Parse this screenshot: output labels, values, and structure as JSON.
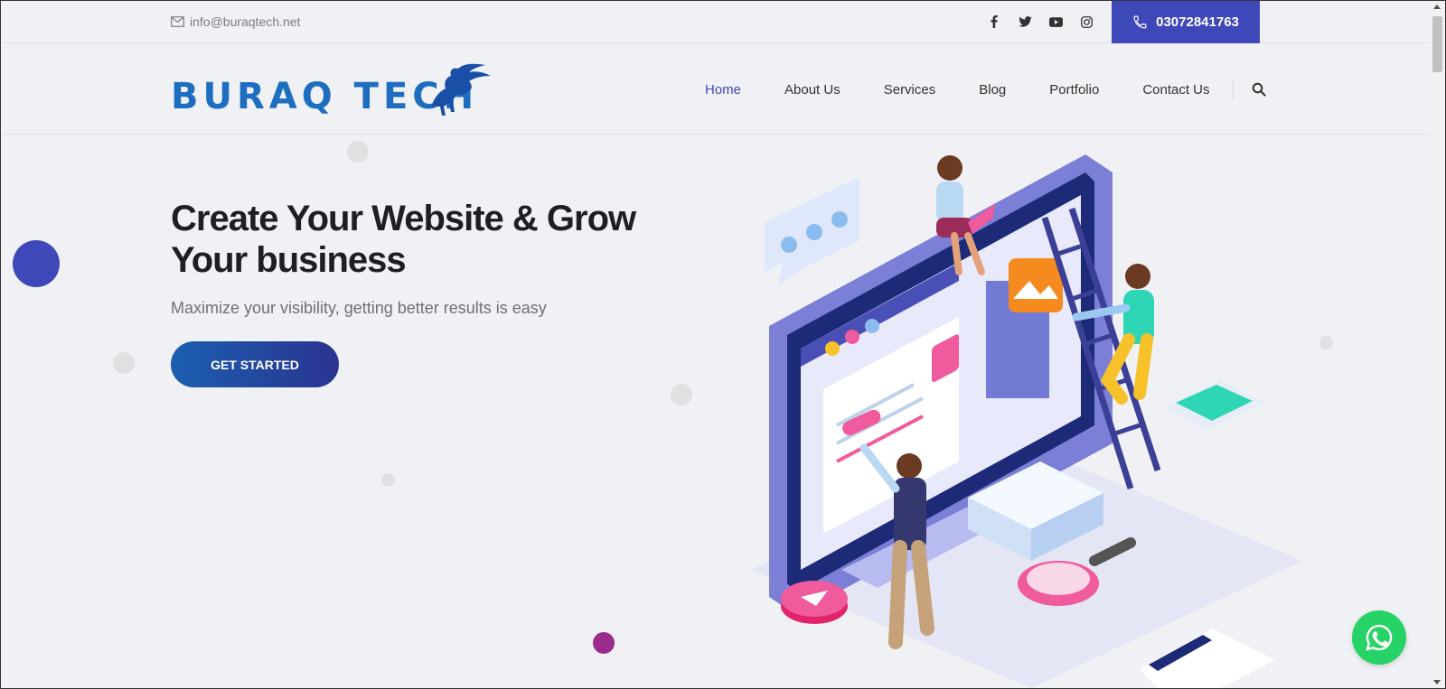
{
  "topbar": {
    "email": "info@buraqtech.net",
    "phone": "03072841763",
    "socials": [
      "facebook-icon",
      "twitter-icon",
      "youtube-icon",
      "instagram-icon"
    ]
  },
  "logo": {
    "text": "BURAQ TECH"
  },
  "nav": {
    "items": [
      {
        "label": "Home",
        "active": true
      },
      {
        "label": "About Us"
      },
      {
        "label": "Services"
      },
      {
        "label": "Blog"
      },
      {
        "label": "Portfolio"
      },
      {
        "label": "Contact Us"
      }
    ]
  },
  "hero": {
    "title": "Create Your Website & Grow Your business",
    "subtitle": "Maximize your visibility, getting better results is easy",
    "cta": "GET STARTED"
  },
  "colors": {
    "accent": "#3f48b8",
    "brand_blue": "#1d6ec0",
    "whatsapp": "#25d366",
    "background": "#f0f1f4"
  }
}
